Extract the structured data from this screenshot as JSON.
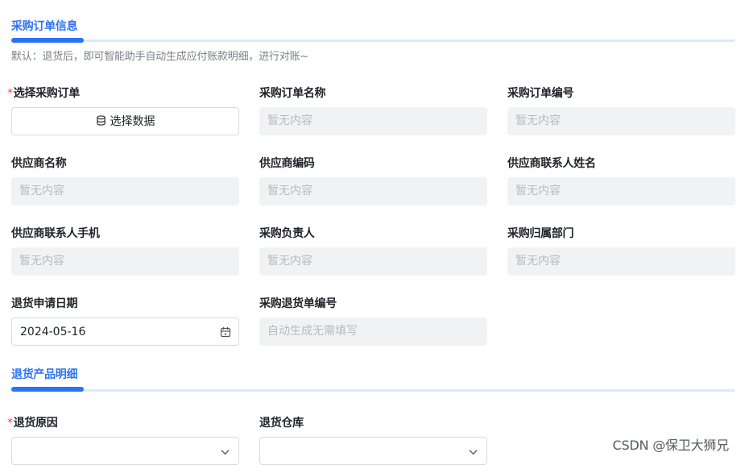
{
  "section1": {
    "title": "采购订单信息"
  },
  "hint": "默认：退货后，即可智能助手自动生成应付账款明细，进行对账~",
  "fields": {
    "select_order": {
      "required_mark": "*",
      "label": "选择采购订单",
      "button_label": "选择数据",
      "button_icon": "database-icon"
    },
    "order_name": {
      "label": "采购订单名称",
      "value": "暂无内容"
    },
    "order_no": {
      "label": "采购订单编号",
      "value": "暂无内容"
    },
    "supplier_name": {
      "label": "供应商名称",
      "value": "暂无内容"
    },
    "supplier_code": {
      "label": "供应商编码",
      "value": "暂无内容"
    },
    "supplier_contact": {
      "label": "供应商联系人姓名",
      "value": "暂无内容"
    },
    "supplier_phone": {
      "label": "供应商联系人手机",
      "value": "暂无内容"
    },
    "purchaser": {
      "label": "采购负责人",
      "value": "暂无内容"
    },
    "department": {
      "label": "采购归属部门",
      "value": "暂无内容"
    },
    "return_date": {
      "label": "退货申请日期",
      "value": "2024-05-16",
      "icon": "calendar-icon"
    },
    "return_no": {
      "label": "采购退货单编号",
      "value": "自动生成无需填写"
    },
    "return_reason": {
      "required_mark": "*",
      "label": "退货原因",
      "value": "",
      "icon": "chevron-down-icon"
    },
    "return_warehouse": {
      "label": "退货仓库",
      "value": "",
      "icon": "chevron-down-icon"
    }
  },
  "section2": {
    "title": "退货产品明细"
  },
  "watermark": "CSDN @保卫大狮兄",
  "colors": {
    "accent": "#2d72f5",
    "required": "#f04a43",
    "readonly_bg": "#f1f2f4",
    "placeholder": "#b7bbc1"
  }
}
